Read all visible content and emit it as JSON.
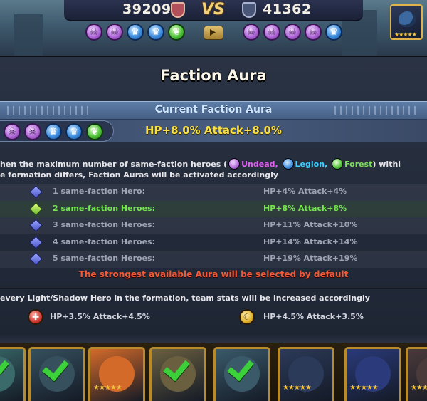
{
  "battle": {
    "left_score": "39209",
    "right_score": "41362",
    "vs_label": "VS",
    "left_factions": [
      "undead",
      "undead",
      "legion",
      "legion",
      "forest"
    ],
    "right_factions": [
      "undead",
      "undead",
      "undead",
      "undead",
      "legion"
    ]
  },
  "modal": {
    "title": "Faction Aura",
    "current_header": "Current Faction Aura",
    "current_factions": [
      "undead",
      "undead",
      "legion",
      "legion",
      "forest"
    ],
    "current_bonus": "HP+8.0% Attack+8.0%",
    "description": {
      "part1": "hen the maximum number of same-faction heroes (",
      "undead": "Undead,",
      "legion": "Legion,",
      "forest": "Forest",
      "part2": ") withi",
      "line2": "e formation differs, Faction Auras will be activated accordingly"
    },
    "tiers": [
      {
        "label": "1 same-faction Hero:",
        "value": "HP+4% Attack+4%",
        "active": false
      },
      {
        "label": "2 same-faction Heroes:",
        "value": "HP+8% Attack+8%",
        "active": true
      },
      {
        "label": "3 same-faction Heroes:",
        "value": "HP+11% Attack+10%",
        "active": false
      },
      {
        "label": "4 same-faction Heroes:",
        "value": "HP+14% Attack+14%",
        "active": false
      },
      {
        "label": "5 same-faction Heroes:",
        "value": "HP+19% Attack+19%",
        "active": false
      }
    ],
    "note": "The strongest available Aura will be selected by default",
    "light_shadow_description": "every Light/Shadow Hero in the formation, team stats will be increased accordingly",
    "light_bonus": "HP+3.5% Attack+4.5%",
    "shadow_bonus": "HP+4.5% Attack+3.5%"
  },
  "colors": {
    "undead": "#b06ad8",
    "legion": "#3e8ee0",
    "forest": "#52c43a",
    "active_green": "#74e84a",
    "bonus_yellow": "#f6e04a",
    "note_red": "#f05a36"
  },
  "roster": [
    {
      "name": "hero-card-1",
      "selected": true,
      "color": "#3a6a6a"
    },
    {
      "name": "hero-card-2",
      "selected": true,
      "color": "#36505e"
    },
    {
      "name": "hero-card-3",
      "selected": false,
      "color": "#d46a2a"
    },
    {
      "name": "hero-card-4",
      "selected": true,
      "color": "#6a6040"
    },
    {
      "name": "hero-card-5",
      "selected": true,
      "color": "#3a5a6a"
    },
    {
      "name": "hero-card-6",
      "selected": false,
      "color": "#2c3a5a"
    },
    {
      "name": "hero-card-7",
      "selected": false,
      "color": "#2a3a7a"
    },
    {
      "name": "hero-card-8",
      "selected": false,
      "color": "#4a3a3a"
    }
  ]
}
